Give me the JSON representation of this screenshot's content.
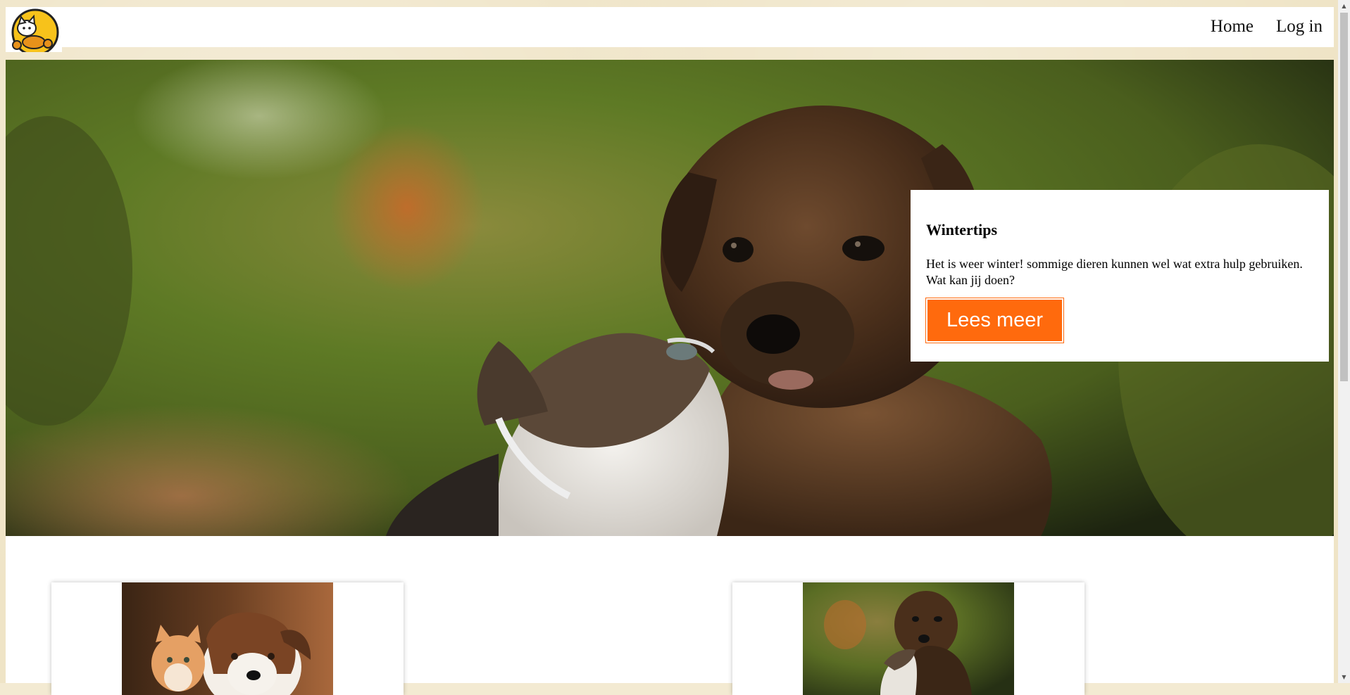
{
  "header": {
    "logo_alt": "paw logo",
    "nav": [
      {
        "label": "Home"
      },
      {
        "label": "Log in"
      }
    ]
  },
  "hero": {
    "image": "puppy-and-kitten-photo",
    "card": {
      "title": "Wintertips",
      "text": "Het is weer winter! sommige dieren kunnen wel wat extra hulp gebruiken. Wat kan jij doen?",
      "button_label": "Lees meer"
    }
  },
  "tiles": [
    {
      "image": "kitten-and-dog-photo"
    },
    {
      "image": "puppy-and-kitten-photo"
    }
  ],
  "colors": {
    "accent": "#ff6a0d",
    "page_background": "#efe4c6"
  }
}
